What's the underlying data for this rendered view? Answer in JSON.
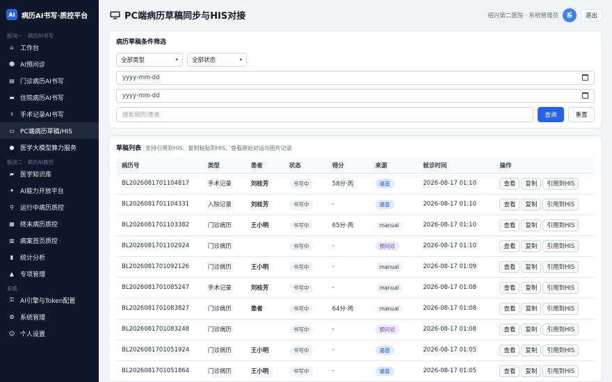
{
  "brand": {
    "logo": "AI",
    "title": "病历AI书写·质控平台"
  },
  "sidebar": {
    "sections": [
      {
        "label": "板块一 · 病历AI书写",
        "items": [
          {
            "icon": "home-icon",
            "glyph": "⌂",
            "label": "工作台"
          },
          {
            "icon": "robot-icon",
            "glyph": "☻",
            "label": "AI预问诊"
          },
          {
            "icon": "clipboard-icon",
            "glyph": "▤",
            "label": "门诊病历AI书写"
          },
          {
            "icon": "bed-icon",
            "glyph": "▬",
            "label": "住院病历AI书写"
          },
          {
            "icon": "scalpel-icon",
            "glyph": "⚕",
            "label": "手术记录AI书写"
          },
          {
            "icon": "monitor-icon",
            "glyph": "▭",
            "label": "PC端病历草稿/HIS",
            "active": true
          },
          {
            "icon": "brain-icon",
            "glyph": "●",
            "label": "医学大模型算力服务"
          }
        ]
      },
      {
        "label": "板块二 · 病历AI质控",
        "items": [
          {
            "icon": "book-icon",
            "glyph": "▰",
            "label": "医学知识库"
          },
          {
            "icon": "plug-icon",
            "glyph": "✦",
            "label": "AI能力开放平台"
          },
          {
            "icon": "magnifier-icon",
            "glyph": "⚲",
            "label": "运行中病历质控"
          },
          {
            "icon": "document-icon",
            "glyph": "▦",
            "label": "终末病历质控"
          },
          {
            "icon": "page-icon",
            "glyph": "▥",
            "label": "病案首页质控"
          },
          {
            "icon": "chart-icon",
            "glyph": "▮",
            "label": "统计分析"
          },
          {
            "icon": "warning-icon",
            "glyph": "▲",
            "label": "专项管理"
          }
        ]
      },
      {
        "label": "系统",
        "items": [
          {
            "icon": "key-icon",
            "glyph": "⚿",
            "label": "AI引擎与Token配置"
          },
          {
            "icon": "gear-icon",
            "glyph": "⚙",
            "label": "系统管理"
          },
          {
            "icon": "user-icon",
            "glyph": "☺",
            "label": "个人设置"
          }
        ]
      }
    ]
  },
  "header": {
    "title": "PC端病历草稿同步与HIS对接",
    "org": "绍兴第二医院 · 系统管理员",
    "avatar": "系",
    "logout": "退出"
  },
  "filter": {
    "title": "病历草稿条件筛选",
    "type_select": "全部类型",
    "status_select": "全部状态",
    "date_from": "yyyy-mm-dd",
    "date_to": "yyyy-mm-dd",
    "search_placeholder": "搜索病历/患者",
    "query": "查询",
    "reset": "重置"
  },
  "list": {
    "title": "草稿列表",
    "subtitle": "支持引用到HIS、复制粘贴到HIS、查看原始对话与图片记录",
    "columns": [
      "病历号",
      "类型",
      "患者",
      "状态",
      "得分",
      "来源",
      "就诊时间",
      "操作"
    ],
    "actions": {
      "view": "查看",
      "copy": "复制",
      "cite": "引用到HIS"
    },
    "rows": [
      {
        "id": "BL2026081701104817",
        "type": "手术记录",
        "patient": "刘桂芳",
        "status": "书写中",
        "score": "58分·丙",
        "source": "语音",
        "source_kind": "voice",
        "time": "2026-08-17 01:10"
      },
      {
        "id": "BL2026081701104331",
        "type": "入院记录",
        "patient": "刘桂芳",
        "status": "书写中",
        "score": "-",
        "source": "语音",
        "source_kind": "voice",
        "time": "2026-08-17 01:10"
      },
      {
        "id": "BL2026081701103382",
        "type": "门诊病历",
        "patient": "王小明",
        "status": "书写中",
        "score": "65分·丙",
        "source": "manual",
        "source_kind": "manual",
        "time": "2026-08-17 01:10"
      },
      {
        "id": "BL2026081701102924",
        "type": "门诊病历",
        "patient": "",
        "status": "书写中",
        "score": "-",
        "source": "预问诊",
        "source_kind": "pre",
        "time": "2026-08-17 01:10"
      },
      {
        "id": "BL2026081701092126",
        "type": "门诊病历",
        "patient": "王小明",
        "status": "书写中",
        "score": "-",
        "source": "manual",
        "source_kind": "manual",
        "time": "2026-08-17 01:09"
      },
      {
        "id": "BL2026081701085247",
        "type": "手术记录",
        "patient": "刘桂芳",
        "status": "书写中",
        "score": "-",
        "source": "manual",
        "source_kind": "manual",
        "time": "2026-08-17 01:08"
      },
      {
        "id": "BL2026081701083827",
        "type": "门诊病历",
        "patient": "患者",
        "status": "书写中",
        "score": "64分·丙",
        "source": "manual",
        "source_kind": "manual",
        "time": "2026-08-17 01:08"
      },
      {
        "id": "BL2026081701083248",
        "type": "门诊病历",
        "patient": "",
        "status": "书写中",
        "score": "-",
        "source": "预问诊",
        "source_kind": "pre",
        "time": "2026-08-17 01:08"
      },
      {
        "id": "BL2026081701051924",
        "type": "门诊病历",
        "patient": "王小明",
        "status": "书写中",
        "score": "-",
        "source": "语音",
        "source_kind": "voice",
        "time": "2026-08-17 01:05"
      },
      {
        "id": "BL2026081701051864",
        "type": "门诊病历",
        "patient": "王小明",
        "status": "书写中",
        "score": "-",
        "source": "语音",
        "source_kind": "voice",
        "time": "2026-08-17 01:05"
      }
    ]
  }
}
